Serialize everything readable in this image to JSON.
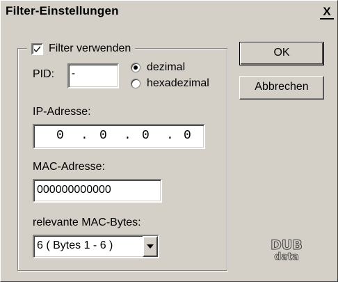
{
  "window": {
    "title": "Filter-Einstellungen",
    "close_label": "X"
  },
  "filter": {
    "use_filter_label": "Filter verwenden",
    "use_filter_checked": true,
    "pid_label": "PID:",
    "pid_value": "-",
    "radio_dezimal": "dezimal",
    "radio_hexadezimal": "hexadezimal",
    "selected_format": "dezimal",
    "ip_label": "IP-Adresse:",
    "ip_octets": [
      "0",
      "0",
      "0",
      "0"
    ],
    "ip_separator": ".",
    "mac_label": "MAC-Adresse:",
    "mac_value": "000000000000",
    "mac_bytes_label": "relevante MAC-Bytes:",
    "mac_bytes_value": "6  ( Bytes 1 - 6 )"
  },
  "buttons": {
    "ok": "OK",
    "cancel": "Abbrechen"
  },
  "logo": {
    "line1": "DUB",
    "line2": "data"
  }
}
